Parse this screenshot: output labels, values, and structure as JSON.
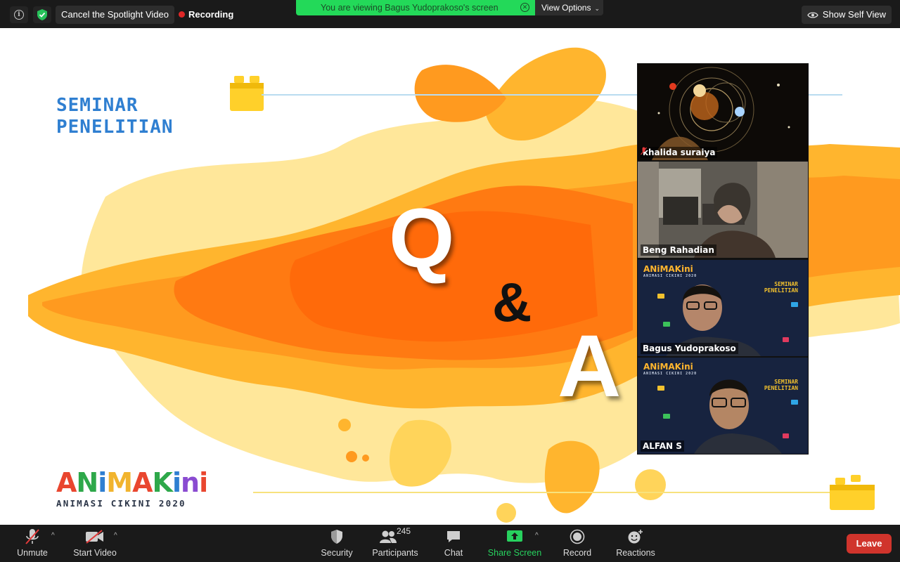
{
  "topbar": {
    "spotlight_label": "Cancel the Spotlight Video",
    "recording_label": "Recording",
    "viewing_label": "You are viewing Bagus Yudoprakoso's screen",
    "view_options_label": "View Options",
    "self_view_label": "Show Self View"
  },
  "slide": {
    "title_line1": "SEMINAR",
    "title_line2": "PENELITIAN",
    "q": "Q",
    "amp": "&",
    "a": "A",
    "logo_letters": [
      "A",
      "N",
      "i",
      "M",
      "A",
      "K",
      "i",
      "n",
      "i"
    ],
    "logo_colors": [
      "#e9462f",
      "#2ea84a",
      "#2f7fd1",
      "#f1b42e",
      "#e9462f",
      "#2ea84a",
      "#2f7fd1",
      "#8a4bd1",
      "#e9462f"
    ],
    "logo_sub": "ANIMASI CIKINI 2020"
  },
  "participants_panel": [
    {
      "name": "khalida suraiya",
      "muted": true
    },
    {
      "name": "Beng Rahadian",
      "muted": false,
      "active": true
    },
    {
      "name": "Bagus Yudoprakoso",
      "muted": false
    },
    {
      "name": "ALFAN S",
      "muted": false
    }
  ],
  "tile_overlay": {
    "brand": "ANiMAKini",
    "brand_sub": "ANIMASI CIKINI 2020",
    "seminar1": "SEMINAR",
    "seminar2": "PENELITIAN"
  },
  "toolbar": {
    "unmute_label": "Unmute",
    "start_video_label": "Start Video",
    "security_label": "Security",
    "participants_label": "Participants",
    "participants_count": "245",
    "chat_label": "Chat",
    "share_label": "Share Screen",
    "record_label": "Record",
    "reactions_label": "Reactions",
    "leave_label": "Leave"
  },
  "colors": {
    "accent_green": "#23d959",
    "leave_red": "#d0342c",
    "active_speaker": "#f3e45a"
  }
}
